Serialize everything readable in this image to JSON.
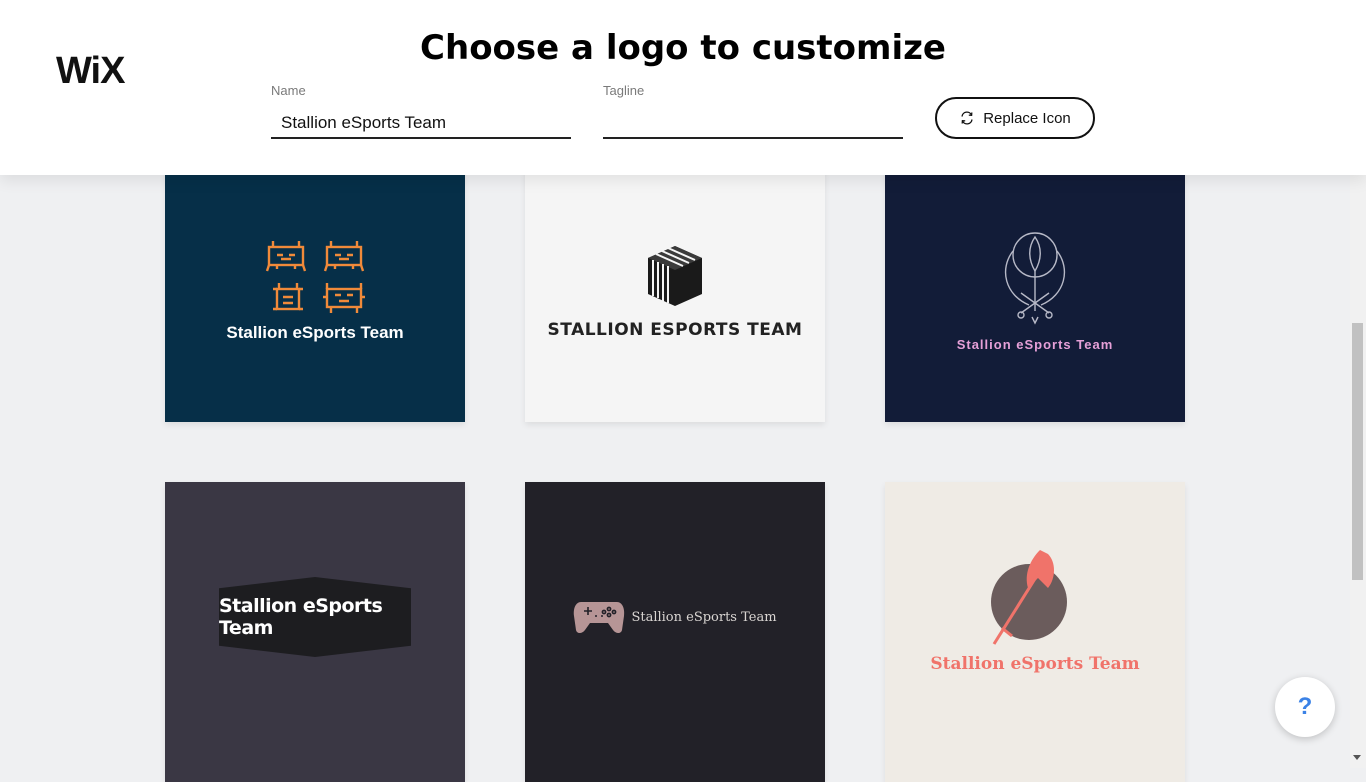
{
  "header": {
    "brand": "WiX",
    "title": "Choose a logo to customize",
    "name_label": "Name",
    "name_value": "Stallion eSports Team",
    "tagline_label": "Tagline",
    "tagline_value": "",
    "replace_icon_label": "Replace Icon"
  },
  "logos": [
    {
      "text": "Stallion eSports Team",
      "background": "#062f48",
      "text_color": "#ffffff",
      "icon": "space-invader-icon"
    },
    {
      "text": "STALLION ESPORTS TEAM",
      "background": "#f5f5f5",
      "text_color": "#222222",
      "icon": "striped-cube-icon"
    },
    {
      "text": "Stallion eSports Team",
      "background": "#121c38",
      "text_color": "#e6a0d8",
      "icon": "khanda-emblem-icon"
    },
    {
      "text": "Stallion eSports Team",
      "background": "#3a3744",
      "text_color": "#ffffff",
      "icon": "hexagon-badge"
    },
    {
      "text": "Stallion eSports Team",
      "background": "#222128",
      "text_color": "#d9d5d2",
      "icon": "gamepad-icon"
    },
    {
      "text": "Stallion eSports Team",
      "background": "#efebe5",
      "text_color": "#f0736a",
      "icon": "battle-axe-icon"
    }
  ],
  "help": {
    "label": "?"
  },
  "colors": {
    "accent": "#3b82e6"
  }
}
